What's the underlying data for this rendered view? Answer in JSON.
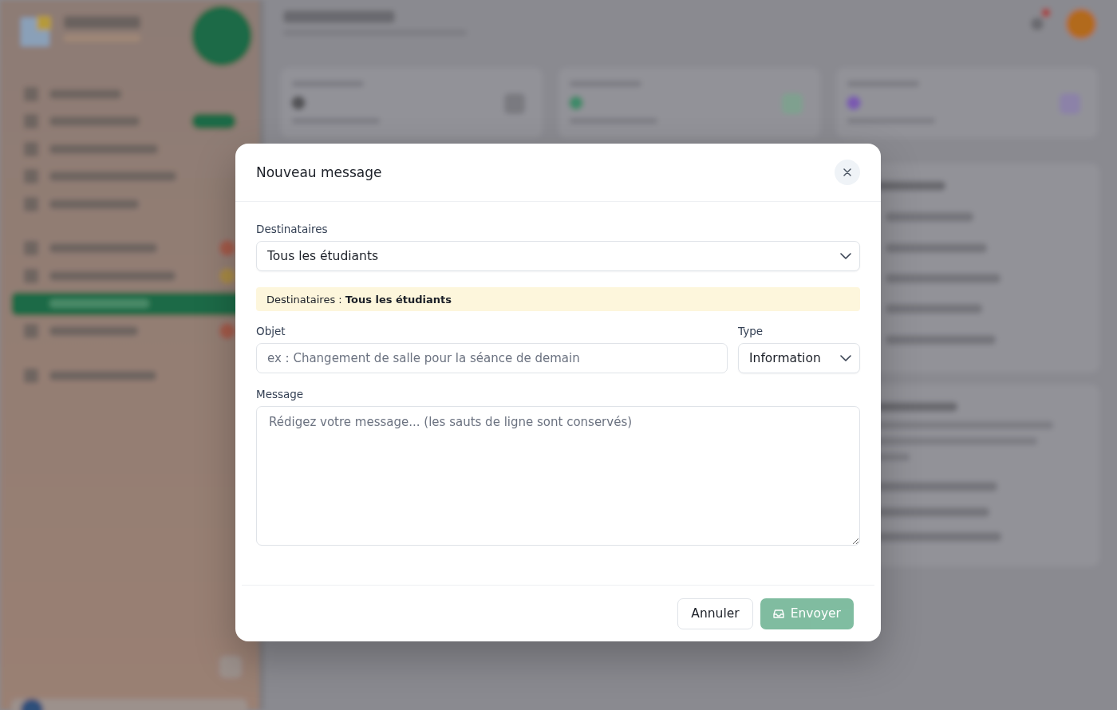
{
  "dialog": {
    "title": "Nouveau message",
    "recipients": {
      "label": "Destinataires",
      "value": "Tous les étudiants"
    },
    "notice": "Destinataires : **Tous les étudiants**",
    "subject": {
      "label": "Objet",
      "placeholder": "ex : Changement de salle pour la séance de demain"
    },
    "type": {
      "label": "Type",
      "value": "Information"
    },
    "message": {
      "label": "Message",
      "placeholder": "Rédigez votre message... (les sauts de ligne sont conservés)"
    },
    "buttons": [
      {
        "kind": "cancel",
        "label": "Annuler",
        "disabled": false
      },
      {
        "kind": "send",
        "label": "Envoyer",
        "disabled": true
      }
    ]
  }
}
